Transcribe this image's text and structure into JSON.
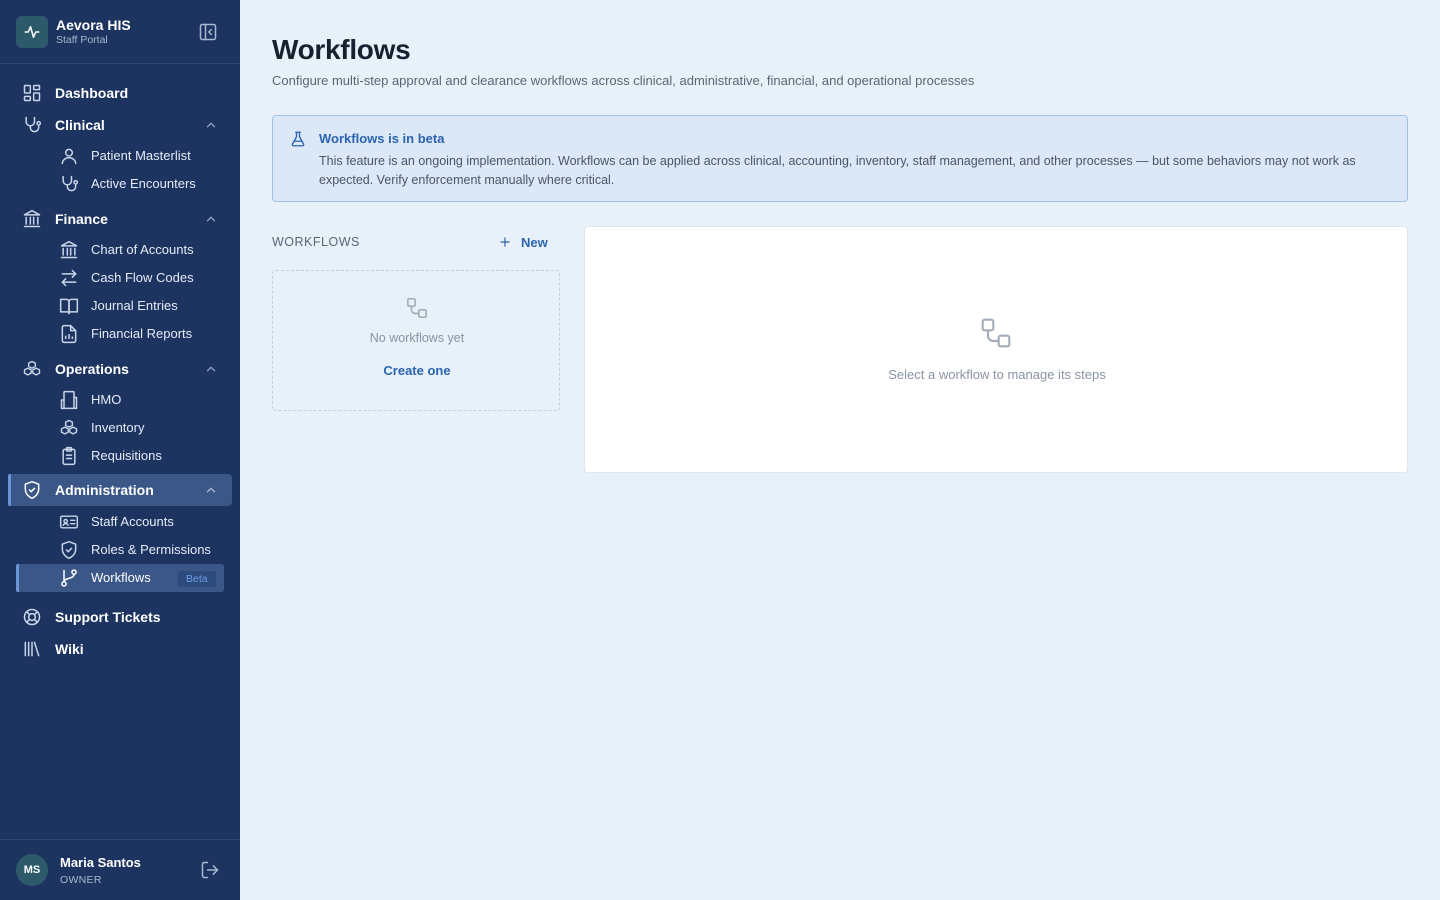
{
  "app": {
    "name": "Aevora HIS",
    "subtitle": "Staff Portal"
  },
  "sidebar": {
    "items": [
      {
        "label": "Dashboard",
        "icon": "dashboard-icon"
      },
      {
        "label": "Clinical",
        "icon": "stethoscope-icon",
        "expanded": true,
        "children": [
          {
            "label": "Patient Masterlist",
            "icon": "user-icon"
          },
          {
            "label": "Active Encounters",
            "icon": "stethoscope-icon"
          }
        ]
      },
      {
        "label": "Finance",
        "icon": "bank-icon",
        "expanded": true,
        "children": [
          {
            "label": "Chart of Accounts",
            "icon": "bank-icon"
          },
          {
            "label": "Cash Flow Codes",
            "icon": "arrows-icon"
          },
          {
            "label": "Journal Entries",
            "icon": "book-icon"
          },
          {
            "label": "Financial Reports",
            "icon": "report-icon"
          }
        ]
      },
      {
        "label": "Operations",
        "icon": "boxes-icon",
        "expanded": true,
        "children": [
          {
            "label": "HMO",
            "icon": "building-icon"
          },
          {
            "label": "Inventory",
            "icon": "boxes-icon"
          },
          {
            "label": "Requisitions",
            "icon": "clipboard-icon"
          }
        ]
      },
      {
        "label": "Administration",
        "icon": "shield-icon",
        "expanded": true,
        "active": true,
        "children": [
          {
            "label": "Staff Accounts",
            "icon": "id-card-icon"
          },
          {
            "label": "Roles & Permissions",
            "icon": "shield-check-icon"
          },
          {
            "label": "Workflows",
            "icon": "git-branch-icon",
            "active": true,
            "badge": "Beta"
          }
        ]
      },
      {
        "label": "Support Tickets",
        "icon": "life-buoy-icon"
      },
      {
        "label": "Wiki",
        "icon": "library-icon"
      }
    ]
  },
  "user": {
    "initials": "MS",
    "name": "Maria Santos",
    "role": "OWNER"
  },
  "page": {
    "title": "Workflows",
    "description": "Configure multi-step approval and clearance workflows across clinical, administrative, financial, and operational processes"
  },
  "banner": {
    "title": "Workflows is in beta",
    "text": "This feature is an ongoing implementation. Workflows can be applied across clinical, accounting, inventory, staff management, and other processes — but some behaviors may not work as expected. Verify enforcement manually where critical."
  },
  "workflows_panel": {
    "header": "WORKFLOWS",
    "new_label": "New",
    "empty_text": "No workflows yet",
    "create_label": "Create one"
  },
  "detail_panel": {
    "empty_text": "Select a workflow to manage its steps"
  },
  "colors": {
    "sidebar_bg": "#1d3461",
    "sidebar_active": "#3a5788",
    "accent": "#2b64b0",
    "page_bg": "#e8f0fa",
    "banner_bg": "#dce8f6"
  }
}
